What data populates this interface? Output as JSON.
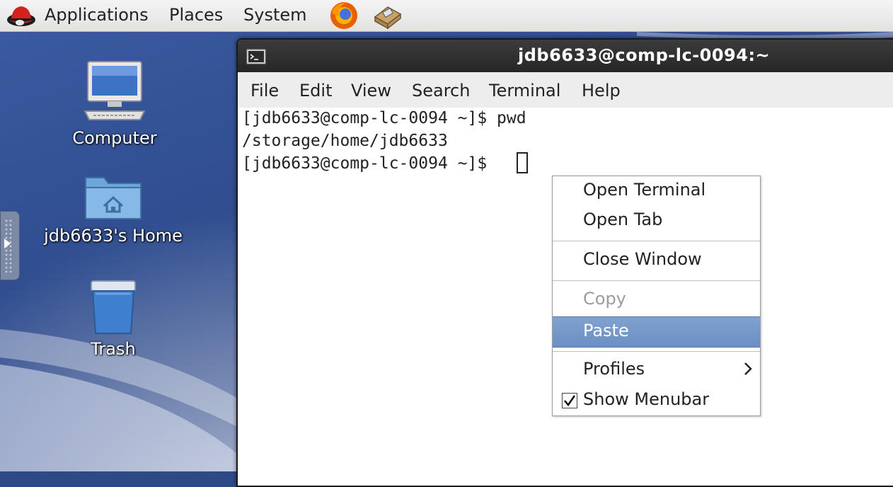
{
  "panel": {
    "menus": [
      "Applications",
      "Places",
      "System"
    ],
    "launchers": [
      "firefox-icon",
      "package-manager-icon"
    ]
  },
  "desktop": {
    "icons": [
      {
        "label": "Computer",
        "icon": "computer-icon"
      },
      {
        "label": "jdb6633's Home",
        "icon": "home-folder-icon"
      },
      {
        "label": "Trash",
        "icon": "trash-icon"
      }
    ]
  },
  "terminal": {
    "title": "jdb6633@comp-lc-0094:~",
    "menubar": [
      "File",
      "Edit",
      "View",
      "Search",
      "Terminal",
      "Help"
    ],
    "lines": [
      "[jdb6633@comp-lc-0094 ~]$ pwd",
      "/storage/home/jdb6633",
      "[jdb6633@comp-lc-0094 ~]$ "
    ]
  },
  "context_menu": {
    "open_terminal": "Open Terminal",
    "open_tab": "Open Tab",
    "close_window": "Close Window",
    "copy": "Copy",
    "paste": "Paste",
    "profiles": "Profiles",
    "show_menubar": "Show Menubar",
    "show_menubar_checked": true,
    "highlighted": "Paste",
    "copy_enabled": false
  },
  "colors": {
    "highlight": "#7a9bcc",
    "titlebar": "#2e2e2e",
    "desktop": "#2f4d8f"
  }
}
